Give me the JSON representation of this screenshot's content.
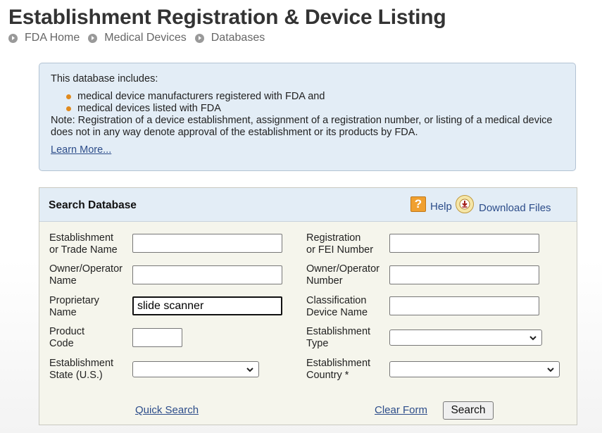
{
  "page": {
    "title": "Establishment Registration & Device Listing"
  },
  "breadcrumb": [
    "FDA Home",
    "Medical Devices",
    "Databases"
  ],
  "info": {
    "intro": "This database includes:",
    "items": [
      "medical device manufacturers registered with FDA and",
      "medical devices listed with FDA"
    ],
    "note": "Note: Registration of a device establishment, assignment of a registration number, or listing of a medical device does not in any way denote approval of the establishment or its products by FDA.",
    "learn_more": "Learn More..."
  },
  "search": {
    "heading": "Search Database",
    "help_label": "Help",
    "download_label": "Download Files",
    "fields": {
      "establishment_name": {
        "label_line1": "Establishment",
        "label_line2": "or Trade Name",
        "value": ""
      },
      "owner_operator_name": {
        "label_line1": "Owner/Operator",
        "label_line2": "Name",
        "value": ""
      },
      "proprietary_name": {
        "label_line1": "Proprietary",
        "label_line2": "Name",
        "value": "slide scanner"
      },
      "product_code": {
        "label_line1": "Product",
        "label_line2": "Code",
        "value": ""
      },
      "establishment_state": {
        "label_line1": "Establishment",
        "label_line2": "State (U.S.)",
        "selected": ""
      },
      "registration_number": {
        "label_line1": "Registration",
        "label_line2": "or FEI Number",
        "value": ""
      },
      "owner_operator_number": {
        "label_line1": "Owner/Operator",
        "label_line2": "Number",
        "value": ""
      },
      "classification_name": {
        "label_line1": "Classification",
        "label_line2": "Device Name",
        "value": ""
      },
      "establishment_type": {
        "label_line1": "Establishment",
        "label_line2": "Type",
        "selected": ""
      },
      "establishment_country": {
        "label_line1": "Establishment",
        "label_line2": "Country *",
        "selected": ""
      }
    },
    "quick_search": "Quick Search",
    "clear_form": "Clear Form",
    "search_button": "Search"
  },
  "colors": {
    "link": "#2d4d8a",
    "info_bg": "#e3edf6",
    "panel_bg": "#f5f5ec",
    "bullet": "#e08a1e"
  },
  "icons": {
    "crumb": "chevron-circle-icon",
    "help": "question-icon",
    "download": "download-icon",
    "select": "chevron-down-icon"
  }
}
